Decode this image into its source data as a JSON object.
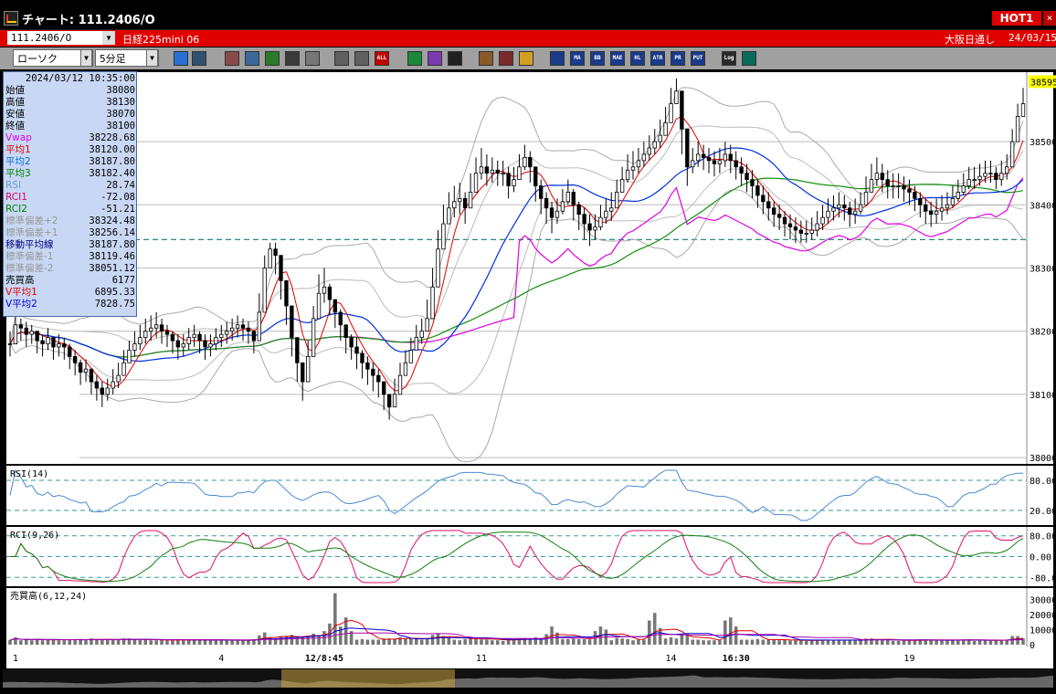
{
  "window": {
    "title": "チャート: 111.2406/O",
    "hot_label": "HOT1",
    "close_label": "×"
  },
  "symbol_bar": {
    "code": "111.2406/O",
    "name": "日経225mini 06",
    "market": "大阪日通し",
    "date": "24/03/15"
  },
  "toolbar": {
    "chart_type": "ローソク",
    "period": "5分足",
    "buttons": [
      "zoom-icon",
      "crosshair-icon",
      "hand-icon",
      "magnify-icon",
      "line-icon",
      "bracket-icon",
      "clear-icon",
      "candle-icon",
      "candle-all-icon",
      "all-label",
      "pencil-icon",
      "arrow-icon",
      "eraser-icon",
      "gear-icon",
      "wrench-icon",
      "palette-icon",
      "grid-icon",
      "ma-label",
      "bb-label",
      "mae-label",
      "hl-label",
      "atr-label",
      "pr-label",
      "put-label",
      "log-label",
      "exit-icon"
    ],
    "button_labels": {
      "all": "ALL",
      "ma": "MA",
      "bb": "BB",
      "mae": "MAE",
      "hl": "HL",
      "atr": "ATR",
      "pr": "PR",
      "put": "PUT",
      "log": "Log"
    }
  },
  "info_panel": {
    "datetime": "2024/03/12  10:35:00",
    "rows": [
      {
        "label": "始値",
        "value": "38080",
        "color": "#000000"
      },
      {
        "label": "高値",
        "value": "38130",
        "color": "#000000"
      },
      {
        "label": "安値",
        "value": "38070",
        "color": "#000000"
      },
      {
        "label": "終値",
        "value": "38100",
        "color": "#000000"
      },
      {
        "label": "Vwap",
        "value": "38228.68",
        "color": "#e000e0"
      },
      {
        "label": "平均1",
        "value": "38120.00",
        "color": "#e00000"
      },
      {
        "label": "平均2",
        "value": "38187.80",
        "color": "#0070e0"
      },
      {
        "label": "平均3",
        "value": "38182.40",
        "color": "#008000"
      },
      {
        "label": "RSI",
        "value": "28.74",
        "color": "#6a9ad0"
      },
      {
        "label": "RCI1",
        "value": "-72.08",
        "color": "#e00060"
      },
      {
        "label": "RCI2",
        "value": "-51.21",
        "color": "#008000"
      },
      {
        "label": "標準偏差+2",
        "value": "38324.48",
        "color": "#999999"
      },
      {
        "label": "標準偏差+1",
        "value": "38256.14",
        "color": "#999999"
      },
      {
        "label": "移動平均線",
        "value": "38187.80",
        "color": "#000080"
      },
      {
        "label": "標準偏差-1",
        "value": "38119.46",
        "color": "#999999"
      },
      {
        "label": "標準偏差-2",
        "value": "38051.12",
        "color": "#999999"
      },
      {
        "label": "売買高",
        "value": "6177",
        "color": "#000000"
      },
      {
        "label": "V平均1",
        "value": "6895.33",
        "color": "#e00000"
      },
      {
        "label": "V平均2",
        "value": "7828.75",
        "color": "#0000e0"
      }
    ]
  },
  "chart_data": {
    "type": "candlestick",
    "price_axis": {
      "ticks": [
        38000,
        38100,
        38200,
        38300,
        38400,
        38500
      ],
      "ylim": [
        37990,
        38610
      ],
      "current_label": "38595",
      "current_value": 38595,
      "current_bg": "#ffff00"
    },
    "x_labels": [
      {
        "text": "1",
        "idx": 1
      },
      {
        "text": "4",
        "idx": 39
      },
      {
        "text": "12/8:45",
        "idx": 58
      },
      {
        "text": "11",
        "idx": 87
      },
      {
        "text": "14",
        "idx": 122
      },
      {
        "text": "16:30",
        "idx": 134
      },
      {
        "text": "19",
        "idx": 166
      }
    ],
    "dashed_level": 38345,
    "close_series": [
      38180,
      38210,
      38205,
      38195,
      38200,
      38185,
      38180,
      38190,
      38175,
      38180,
      38175,
      38160,
      38150,
      38135,
      38140,
      38120,
      38110,
      38100,
      38110,
      38120,
      38130,
      38150,
      38170,
      38180,
      38190,
      38200,
      38205,
      38210,
      38200,
      38195,
      38185,
      38175,
      38180,
      38190,
      38195,
      38185,
      38175,
      38180,
      38190,
      38195,
      38200,
      38205,
      38210,
      38205,
      38200,
      38185,
      38230,
      38300,
      38330,
      38320,
      38280,
      38240,
      38190,
      38150,
      38120,
      38160,
      38220,
      38260,
      38270,
      38250,
      38230,
      38210,
      38190,
      38175,
      38165,
      38150,
      38140,
      38130,
      38120,
      38100,
      38080,
      38100,
      38130,
      38150,
      38170,
      38190,
      38200,
      38220,
      38270,
      38330,
      38370,
      38395,
      38405,
      38410,
      38395,
      38420,
      38450,
      38460,
      38450,
      38455,
      38450,
      38450,
      38430,
      38440,
      38460,
      38475,
      38460,
      38430,
      38410,
      38395,
      38380,
      38390,
      38405,
      38420,
      38400,
      38385,
      38370,
      38360,
      38365,
      38380,
      38390,
      38395,
      38420,
      38440,
      38455,
      38460,
      38470,
      38480,
      38490,
      38500,
      38510,
      38530,
      38560,
      38580,
      38520,
      38460,
      38470,
      38480,
      38475,
      38470,
      38465,
      38470,
      38480,
      38470,
      38460,
      38450,
      38440,
      38430,
      38415,
      38405,
      38395,
      38385,
      38380,
      38370,
      38365,
      38360,
      38355,
      38355,
      38360,
      38370,
      38380,
      38390,
      38395,
      38400,
      38395,
      38385,
      38390,
      38400,
      38420,
      38440,
      38450,
      38440,
      38430,
      38430,
      38430,
      38425,
      38420,
      38410,
      38400,
      38390,
      38385,
      38390,
      38395,
      38400,
      38410,
      38420,
      38430,
      38440,
      38440,
      38445,
      38450,
      38450,
      38440,
      38450,
      38460,
      38500,
      38540,
      38560
    ],
    "high_series": [
      38200,
      38225,
      38220,
      38215,
      38210,
      38200,
      38195,
      38205,
      38190,
      38195,
      38190,
      38180,
      38170,
      38155,
      38155,
      38140,
      38130,
      38120,
      38125,
      38140,
      38150,
      38170,
      38185,
      38200,
      38210,
      38220,
      38225,
      38230,
      38220,
      38210,
      38200,
      38195,
      38195,
      38205,
      38210,
      38200,
      38195,
      38195,
      38205,
      38210,
      38215,
      38220,
      38225,
      38220,
      38215,
      38200,
      38260,
      38320,
      38340,
      38340,
      38300,
      38260,
      38215,
      38175,
      38150,
      38185,
      38240,
      38290,
      38300,
      38275,
      38250,
      38235,
      38210,
      38195,
      38190,
      38170,
      38160,
      38150,
      38140,
      38120,
      38100,
      38125,
      38150,
      38170,
      38190,
      38210,
      38220,
      38250,
      38300,
      38360,
      38400,
      38420,
      38430,
      38435,
      38420,
      38450,
      38475,
      38490,
      38480,
      38475,
      38470,
      38470,
      38460,
      38460,
      38480,
      38495,
      38485,
      38460,
      38440,
      38420,
      38405,
      38410,
      38425,
      38440,
      38425,
      38405,
      38395,
      38385,
      38385,
      38400,
      38410,
      38420,
      38440,
      38460,
      38480,
      38485,
      38490,
      38500,
      38510,
      38520,
      38535,
      38555,
      38585,
      38600,
      38560,
      38495,
      38490,
      38500,
      38495,
      38490,
      38485,
      38490,
      38500,
      38495,
      38485,
      38475,
      38465,
      38455,
      38440,
      38430,
      38420,
      38405,
      38400,
      38390,
      38385,
      38380,
      38375,
      38375,
      38380,
      38390,
      38400,
      38410,
      38415,
      38420,
      38415,
      38405,
      38410,
      38420,
      38445,
      38465,
      38475,
      38465,
      38455,
      38450,
      38450,
      38445,
      38440,
      38430,
      38420,
      38410,
      38405,
      38410,
      38415,
      38420,
      38430,
      38440,
      38450,
      38460,
      38460,
      38465,
      38470,
      38470,
      38460,
      38470,
      38480,
      38520,
      38560,
      38585
    ],
    "low_series": [
      38160,
      38190,
      38185,
      38175,
      38180,
      38165,
      38160,
      38170,
      38155,
      38160,
      38155,
      38140,
      38130,
      38115,
      38120,
      38100,
      38090,
      38080,
      38090,
      38100,
      38110,
      38130,
      38150,
      38160,
      38170,
      38180,
      38185,
      38190,
      38180,
      38175,
      38165,
      38155,
      38160,
      38170,
      38175,
      38165,
      38155,
      38160,
      38170,
      38175,
      38180,
      38185,
      38190,
      38185,
      38180,
      38165,
      38210,
      38280,
      38310,
      38290,
      38250,
      38210,
      38160,
      38120,
      38090,
      38130,
      38200,
      38240,
      38245,
      38225,
      38205,
      38185,
      38165,
      38155,
      38140,
      38125,
      38115,
      38105,
      38095,
      38075,
      38060,
      38080,
      38110,
      38130,
      38150,
      38170,
      38180,
      38200,
      38250,
      38310,
      38345,
      38370,
      38380,
      38385,
      38370,
      38400,
      38430,
      38440,
      38430,
      38435,
      38430,
      38430,
      38410,
      38420,
      38440,
      38455,
      38435,
      38405,
      38385,
      38370,
      38355,
      38370,
      38385,
      38400,
      38375,
      38360,
      38345,
      38335,
      38345,
      38360,
      38370,
      38375,
      38400,
      38420,
      38435,
      38440,
      38450,
      38460,
      38470,
      38480,
      38490,
      38510,
      38540,
      38560,
      38480,
      38430,
      38450,
      38460,
      38455,
      38450,
      38445,
      38450,
      38460,
      38450,
      38440,
      38430,
      38420,
      38410,
      38395,
      38385,
      38375,
      38365,
      38360,
      38350,
      38345,
      38340,
      38340,
      38340,
      38345,
      38350,
      38360,
      38370,
      38375,
      38380,
      38375,
      38365,
      38370,
      38385,
      38400,
      38420,
      38430,
      38420,
      38410,
      38410,
      38410,
      38405,
      38400,
      38390,
      38380,
      38370,
      38365,
      38370,
      38375,
      38385,
      38395,
      38405,
      38415,
      38425,
      38425,
      38430,
      38435,
      38435,
      38425,
      38430,
      38440,
      38480,
      38520,
      38540
    ],
    "rsi": {
      "label": "RSI(14)",
      "ticks": [
        20,
        80
      ],
      "tick_labels": [
        "20.00",
        "80.00"
      ]
    },
    "rci": {
      "label": "RCI(9,26)",
      "ticks": [
        80,
        0,
        -80
      ],
      "tick_labels": [
        "80.00",
        "0.00",
        "-80.0"
      ]
    },
    "volume": {
      "label": "売買高(6,12,24)",
      "ticks": [
        0,
        10000,
        20000,
        30000
      ],
      "tick_labels": [
        "0",
        "10000",
        "20000",
        "30000"
      ],
      "spikes": {
        "58": 9000,
        "59": 14000,
        "60": 34000,
        "61": 12000,
        "62": 18000,
        "63": 9000,
        "99": 7000,
        "100": 12000,
        "101": 8000,
        "108": 9000,
        "109": 12000,
        "110": 10000,
        "118": 16000,
        "119": 21000,
        "120": 11000,
        "132": 16000,
        "133": 18000,
        "134": 12000,
        "190": 9000,
        "191": 14000,
        "192": 11000
      }
    }
  }
}
